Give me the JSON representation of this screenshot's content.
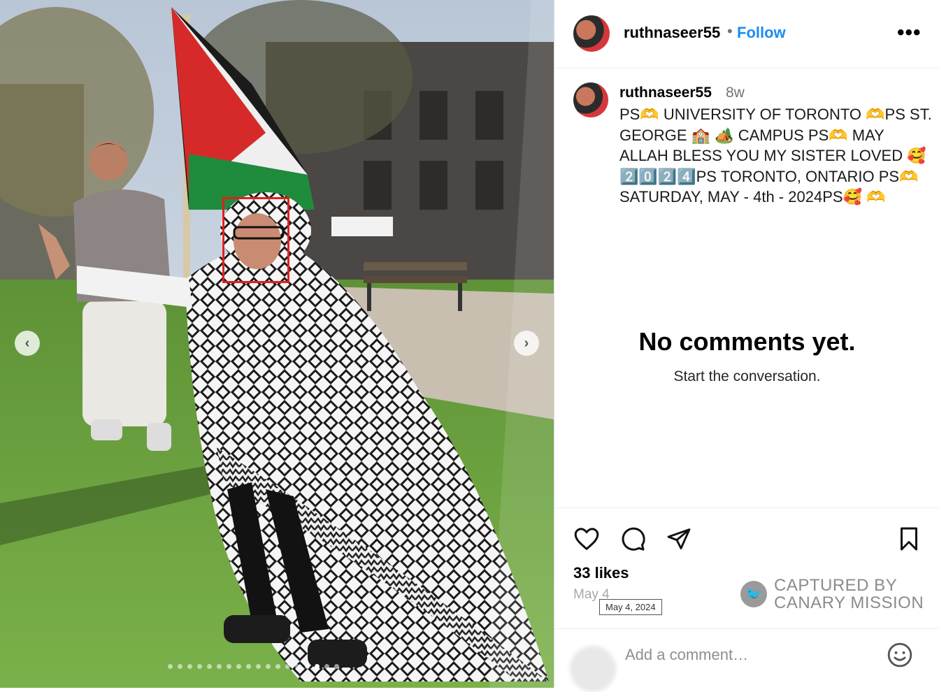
{
  "post": {
    "username": "ruthnaseer55",
    "separator": "•",
    "follow_label": "Follow",
    "more_label": "•••",
    "caption": {
      "username": "ruthnaseer55",
      "time": "8w",
      "lines": [
        "PS🫶 UNIVERSITY OF TORONTO 🫶PS ST.",
        "GEORGE 🏫 🏕️ CAMPUS PS🫶 MAY",
        "ALLAH BLESS YOU MY SISTER LOVED 🥰",
        "2️⃣0️⃣2️⃣4️⃣PS TORONTO, ONTARIO PS🫶",
        "SATURDAY, MAY - 4th - 2024PS🥰 🫶"
      ]
    },
    "comments_empty_title": "No comments yet.",
    "comments_empty_sub": "Start the conversation.",
    "likes": "33 likes",
    "date": "May 4",
    "date_tooltip": "May 4, 2024",
    "add_comment_placeholder": "Add a comment…",
    "carousel": {
      "total": 18,
      "active_index": 15
    }
  },
  "watermark": {
    "line1": "CAPTURED BY",
    "line2": "CANARY MISSION"
  },
  "icons": [
    "heart-icon",
    "comment-icon",
    "share-icon",
    "bookmark-icon",
    "emoji-icon",
    "chevron-left-icon",
    "chevron-right-icon"
  ]
}
